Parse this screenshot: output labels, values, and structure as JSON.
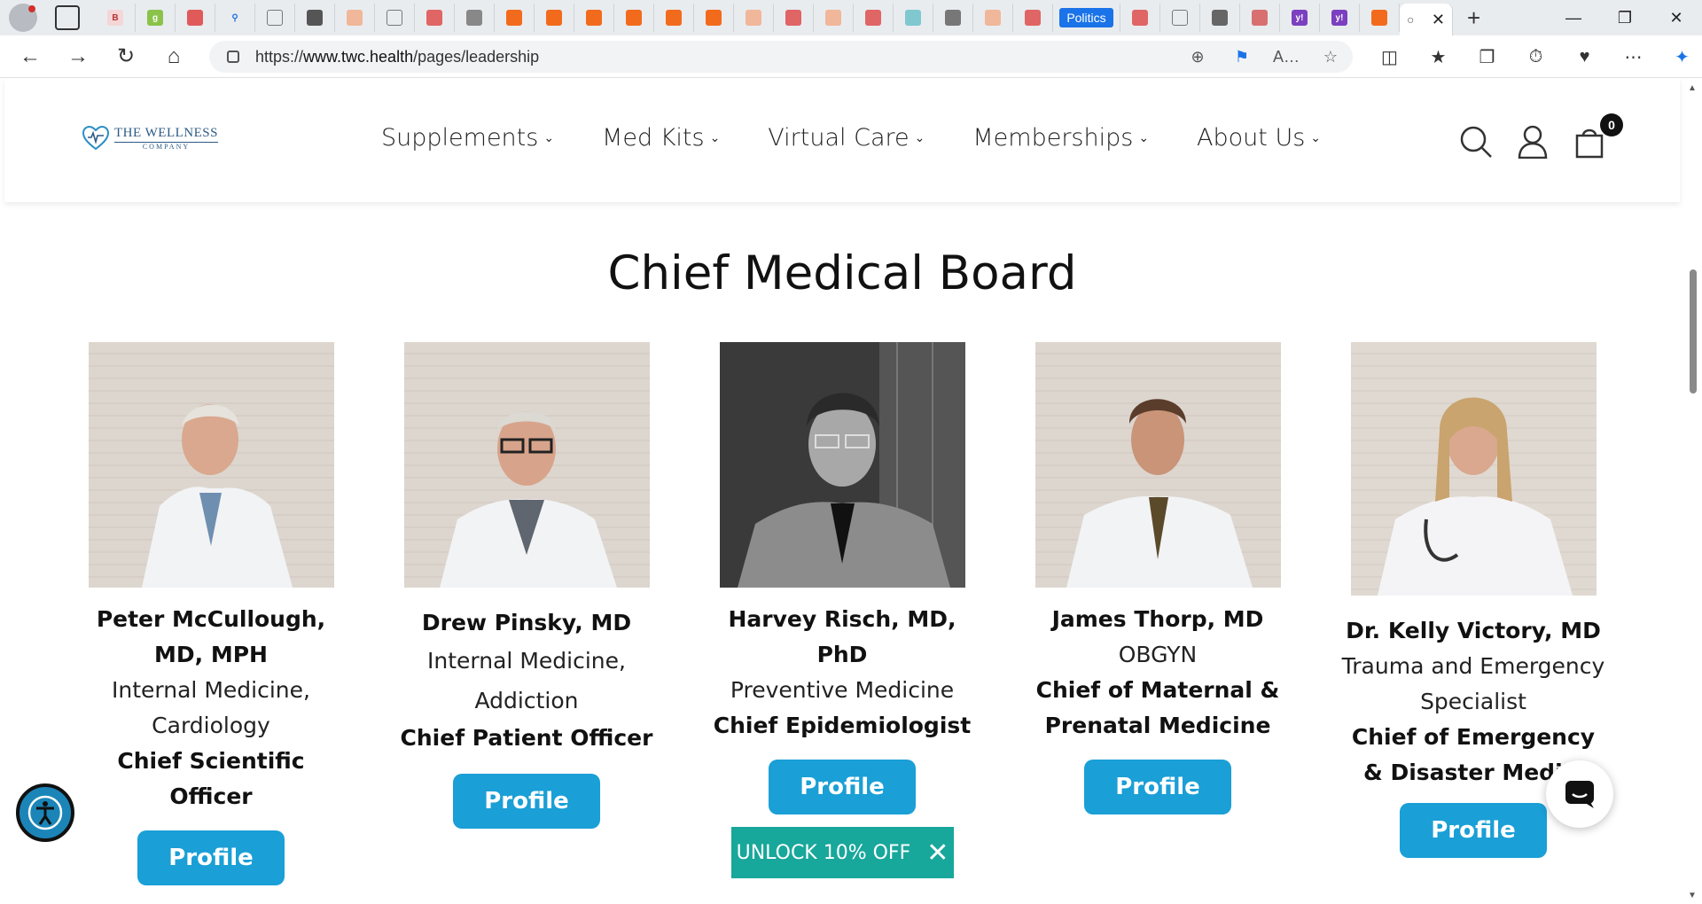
{
  "browser": {
    "politics_tab_label": "Politics",
    "url_prefix": "https://",
    "url_host": "www.twc.health",
    "url_path": "/pages/leadership"
  },
  "header": {
    "logo_line1": "THE WELLNESS",
    "logo_line2": "COMPANY",
    "nav": [
      "Supplements",
      "Med Kits",
      "Virtual Care",
      "Memberships",
      "About Us"
    ],
    "cart_count": "0"
  },
  "section_title": "Chief Medical Board",
  "board": [
    {
      "name": "Peter McCullough, MD, MPH",
      "specialty": "Internal Medicine, Cardiology",
      "role": "Chief Scientific Officer",
      "button": "Profile"
    },
    {
      "name": "Drew Pinsky, MD",
      "specialty": "Internal Medicine, Addiction",
      "role": "Chief Patient Officer",
      "button": "Profile"
    },
    {
      "name": "Harvey Risch, MD, PhD",
      "specialty": "Preventive Medicine",
      "role": "Chief Epidemiologist",
      "button": "Profile"
    },
    {
      "name": "James Thorp, MD",
      "specialty": "OBGYN",
      "role": "Chief of Maternal & Prenatal Medicine",
      "button": "Profile"
    },
    {
      "name": "Dr. Kelly Victory, MD",
      "specialty": "Trauma and Emergency Specialist",
      "role": "Chief of Emergency & Disaster Medici",
      "button": "Profile"
    }
  ],
  "promo": {
    "label": "UNLOCK 10% OFF"
  },
  "colors": {
    "button": "#1a9fd6",
    "promo": "#18a79b",
    "accessibility": "#1b85b8"
  }
}
